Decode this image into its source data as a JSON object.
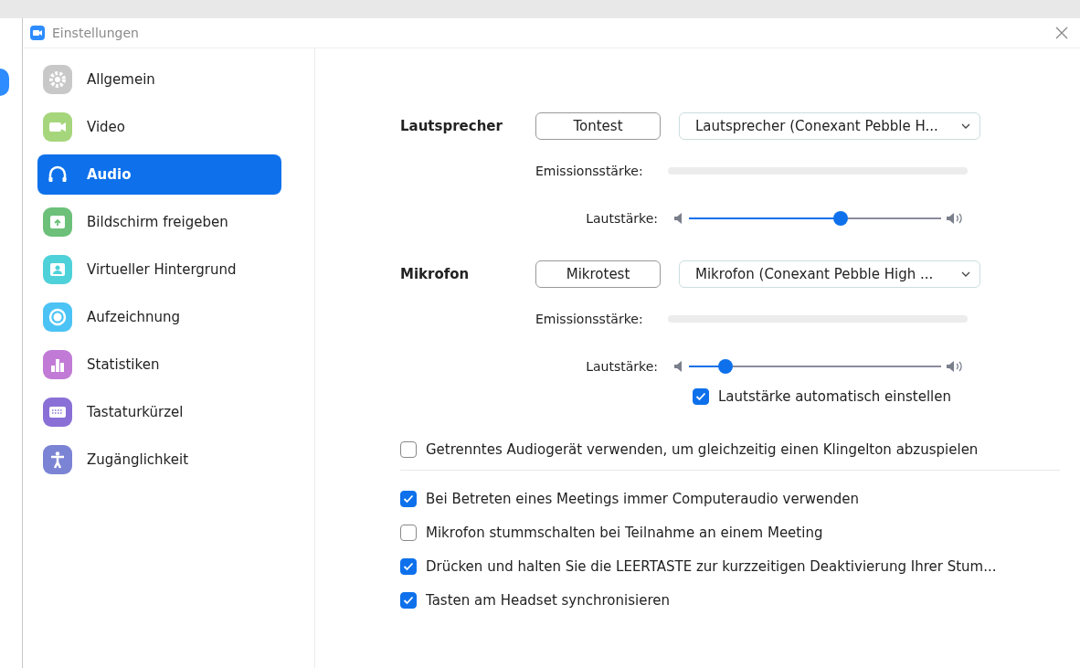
{
  "window": {
    "title": "Einstellungen"
  },
  "sidebar": {
    "items": [
      {
        "label": "Allgemein",
        "kind": "gear",
        "color": "#c8c8c8",
        "selected": false
      },
      {
        "label": "Video",
        "kind": "camera",
        "color": "#a6d67c",
        "selected": false
      },
      {
        "label": "Audio",
        "kind": "headphones",
        "color": "#0e71eb",
        "selected": true
      },
      {
        "label": "Bildschirm freigeben",
        "kind": "share",
        "color": "#6cc07a",
        "selected": false
      },
      {
        "label": "Virtueller Hintergrund",
        "kind": "person",
        "color": "#4fd1d9",
        "selected": false
      },
      {
        "label": "Aufzeichnung",
        "kind": "record",
        "color": "#4cc3f5",
        "selected": false
      },
      {
        "label": "Statistiken",
        "kind": "stats",
        "color": "#c17bd6",
        "selected": false
      },
      {
        "label": "Tastaturkürzel",
        "kind": "keyboard",
        "color": "#8a70d6",
        "selected": false
      },
      {
        "label": "Zugänglichkeit",
        "kind": "accessibility",
        "color": "#7b83d4",
        "selected": false
      }
    ]
  },
  "sections": [
    {
      "title": "Lautsprecher",
      "test_button": "Tontest",
      "device": "Lautsprecher (Conexant Pebble H...",
      "emission_label": "Emissionsstärke:",
      "volume_label": "Lautstärke:",
      "volume": {
        "level": 0.6
      }
    },
    {
      "title": "Mikrofon",
      "test_button": "Mikrotest",
      "device": "Mikrofon (Conexant Pebble High ...",
      "emission_label": "Emissionsstärke:",
      "volume_label": "Lautstärke:",
      "volume": {
        "level": 0.145
      },
      "auto_volume": {
        "label": "Lautstärke automatisch einstellen",
        "checked": true
      }
    }
  ],
  "option_groups": [
    [
      {
        "label": "Getrenntes Audiogerät verwenden, um gleichzeitig einen Klingelton abzuspielen",
        "checked": false
      }
    ],
    [
      {
        "label": "Bei Betreten eines Meetings immer Computeraudio verwenden",
        "checked": true
      },
      {
        "label": "Mikrofon stummschalten bei Teilnahme an einem Meeting",
        "checked": false
      },
      {
        "label": "Drücken und halten Sie die LEERTASTE zur kurzzeitigen Deaktivierung Ihrer Stum...",
        "checked": true
      },
      {
        "label": "Tasten am Headset synchronisieren",
        "checked": true
      }
    ]
  ]
}
